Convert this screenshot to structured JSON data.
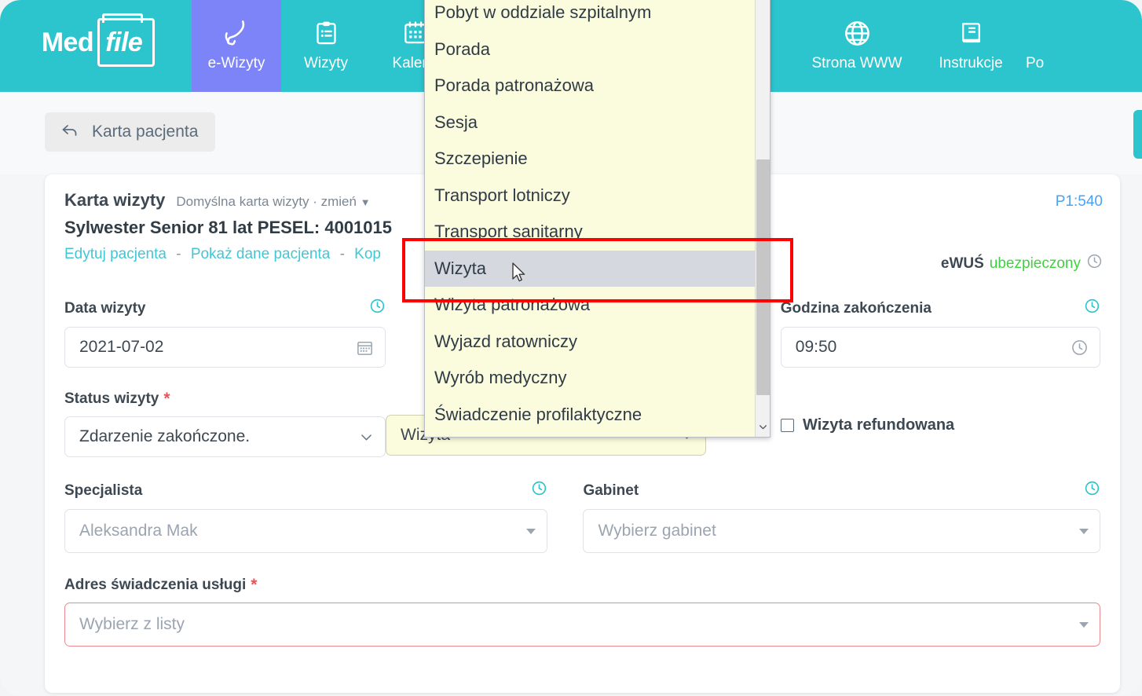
{
  "app": {
    "brand_med": "Med",
    "brand_file": "file"
  },
  "nav": {
    "items": [
      {
        "label": "e-Wizyty",
        "icon": "phone-icon",
        "active": true
      },
      {
        "label": "Wizyty",
        "icon": "clipboard-icon",
        "active": false
      },
      {
        "label": "Kalend",
        "icon": "calendar-icon",
        "active": false
      },
      {
        "label": "Strona WWW",
        "icon": "globe-icon",
        "active": false
      },
      {
        "label": "Instrukcje",
        "icon": "book-icon",
        "active": false
      },
      {
        "label": "Po",
        "icon": "none",
        "active": false
      }
    ]
  },
  "subbar": {
    "back_label": "Karta pacjenta",
    "back_icon": "back-arrow-icon"
  },
  "card": {
    "title": "Karta wizyty",
    "subtitle": "Domyślna karta wizyty · zmień",
    "patient": "Sylwester Senior 81 lat PESEL: 4001015",
    "links": [
      "Edytuj pacjenta",
      "Pokaż dane pacjenta",
      "Kop"
    ],
    "link_separator": "-",
    "p1_badge": "P1:540",
    "ewus_key": "eWUŚ",
    "ewus_value": "ubezpieczony"
  },
  "form": {
    "date_label": "Data wizyty",
    "date_value": "2021-07-02",
    "end_time_label": "Godzina zakończenia",
    "end_time_value": "09:50",
    "status_label": "Status wizyty",
    "status_required": "*",
    "status_value": "Zdarzenie zakończone.",
    "type_value": "Wizyta",
    "refunded_label": "Wizyta refundowana",
    "specialist_label": "Specjalista",
    "specialist_value": "Aleksandra Mak",
    "office_label": "Gabinet",
    "office_placeholder": "Wybierz gabinet",
    "address_label": "Adres świadczenia usługi",
    "address_required": "*",
    "address_placeholder": "Wybierz z listy"
  },
  "dropdown": {
    "options": [
      "Pobyt w oddziale szpitalnym",
      "Porada",
      "Porada patronażowa",
      "Sesja",
      "Szczepienie",
      "Transport lotniczy",
      "Transport sanitarny",
      "Wizyta",
      "Wizyta patronażowa",
      "Wyjazd ratowniczy",
      "Wyrób medyczny",
      "Świadczenie profilaktyczne"
    ],
    "highlighted": "Wizyta"
  },
  "colors": {
    "brand_teal": "#2cc5cd",
    "active_purple": "#7c84f7",
    "link_teal": "#41c7d4",
    "insured_green": "#3fd23f",
    "p1_blue": "#4aa3f0",
    "required_red": "#e8565a",
    "dropdown_yellow": "#fbfbdd",
    "annotation_red": "#ff0000"
  }
}
